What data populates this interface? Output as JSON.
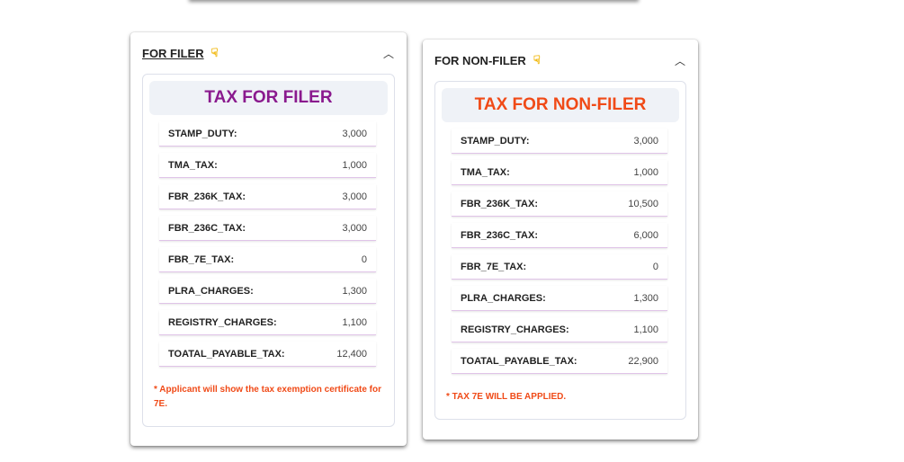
{
  "filer": {
    "header": "FOR FILER",
    "title": "TAX FOR FILER",
    "title_color": "#8a1a8e",
    "rows": [
      {
        "k": "STAMP_DUTY:",
        "v": "3,000"
      },
      {
        "k": "TMA_TAX:",
        "v": "1,000"
      },
      {
        "k": "FBR_236K_TAX:",
        "v": "3,000"
      },
      {
        "k": "FBR_236C_TAX:",
        "v": "3,000"
      },
      {
        "k": "FBR_7E_TAX:",
        "v": "0"
      },
      {
        "k": "PLRA_CHARGES:",
        "v": "1,300"
      },
      {
        "k": "REGISTRY_CHARGES:",
        "v": "1,100"
      },
      {
        "k": "TOATAL_PAYABLE_TAX:",
        "v": "12,400"
      }
    ],
    "note": "* Applicant will show the tax exemption certificate for 7E."
  },
  "nonfiler": {
    "header": "FOR NON-FILER",
    "title": "TAX FOR NON-FILER",
    "title_color": "#f04a17",
    "rows": [
      {
        "k": "STAMP_DUTY:",
        "v": "3,000"
      },
      {
        "k": "TMA_TAX:",
        "v": "1,000"
      },
      {
        "k": "FBR_236K_TAX:",
        "v": "10,500"
      },
      {
        "k": "FBR_236C_TAX:",
        "v": "6,000"
      },
      {
        "k": "FBR_7E_TAX:",
        "v": "0"
      },
      {
        "k": "PLRA_CHARGES:",
        "v": "1,300"
      },
      {
        "k": "REGISTRY_CHARGES:",
        "v": "1,100"
      },
      {
        "k": "TOATAL_PAYABLE_TAX:",
        "v": "22,900"
      }
    ],
    "note": "* TAX 7E WILL BE APPLIED."
  },
  "icons": {
    "hand": "pointing-hand-icon",
    "chevron": "chevron-up-icon"
  }
}
